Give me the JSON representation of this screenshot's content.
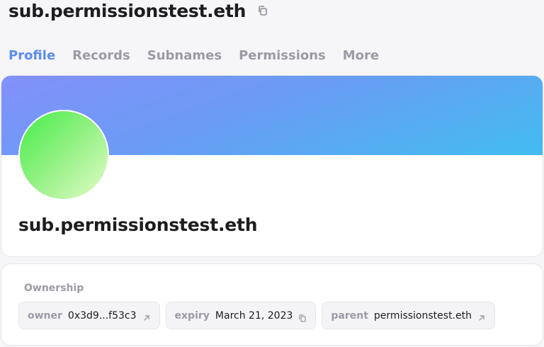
{
  "header": {
    "title": "sub.permissionstest.eth",
    "copy_icon": "copy-icon"
  },
  "tabs": [
    {
      "label": "Profile",
      "active": true
    },
    {
      "label": "Records",
      "active": false
    },
    {
      "label": "Subnames",
      "active": false
    },
    {
      "label": "Permissions",
      "active": false
    },
    {
      "label": "More",
      "active": false
    }
  ],
  "profile": {
    "name": "sub.permissionstest.eth",
    "colors": {
      "banner": [
        "#8391fb",
        "#42bdef"
      ],
      "avatar": [
        "#44ee4a",
        "#e3fcc8"
      ]
    }
  },
  "ownership": {
    "label": "Ownership",
    "items": [
      {
        "key": "owner",
        "value": "0x3d9...f53c3",
        "icon": "external-link-icon"
      },
      {
        "key": "expiry",
        "value": "March 21, 2023",
        "icon": "copy-icon"
      },
      {
        "key": "parent",
        "value": "permissionstest.eth",
        "icon": "external-link-icon"
      }
    ]
  },
  "colors": {
    "accent": "#5b8cf0",
    "muted": "#9b9ba5",
    "text": "#1d1d20"
  }
}
